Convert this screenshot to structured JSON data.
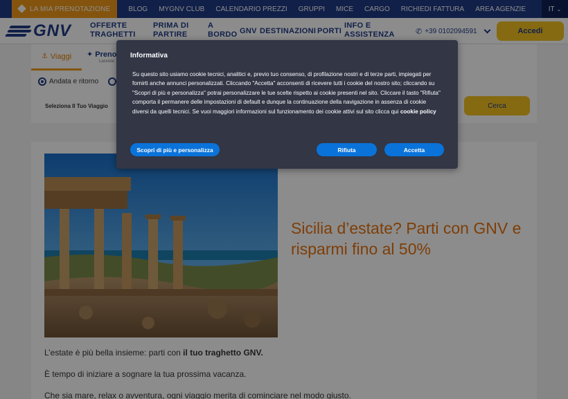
{
  "topbar": {
    "prenotazione": "LA MIA PRENOTAZIONE",
    "links": [
      "BLOG",
      "MYGNV CLUB",
      "CALENDARIO PREZZI",
      "GRUPPI",
      "MICE",
      "CARGO",
      "RICHIEDI FATTURA",
      "AREA AGENZIE"
    ],
    "language": "IT"
  },
  "nav": {
    "logo": "GNV",
    "items": [
      {
        "line1": "OFFERTE",
        "line2": "TRAGHETTI"
      },
      {
        "line1": "PRIMA DI",
        "line2": "PARTIRE"
      },
      {
        "line1": "A",
        "line2": "BORDO"
      },
      {
        "line1": "GNV",
        "line2": ""
      },
      {
        "line1": "DESTINAZIONI",
        "line2": ""
      },
      {
        "line1": "PORTI",
        "line2": ""
      },
      {
        "line1": "INFO E",
        "line2": "ASSISTENZA"
      }
    ],
    "phone": "+39 0102094591",
    "login": "Accedi"
  },
  "booking": {
    "tab_viaggi": "Viaggi",
    "tab_prenota": "Preno",
    "tab_prenota_sub": "Lassiste",
    "trip_type_selected": "Andata e ritorno",
    "select_label": "Seleziona Il Tuo Viaggio",
    "search": "Cerca"
  },
  "article": {
    "headline": "Sicilia d’estate? Parti con GNV e risparmi fino al 50%",
    "p1_pre": "L’estate è più bella insieme: parti con ",
    "p1_bold": "il tuo traghetto GNV.",
    "p2": "È tempo di iniziare a sognare la tua prossima vacanza.",
    "p3": "Che sia mare, relax o avventura, ogni viaggio merita di cominciare nel modo giusto."
  },
  "cookie_modal": {
    "title": "Informativa",
    "body": "Su questo sito usiamo cookie tecnici, analitici e, previo tuo consenso, di profilazione nostri e di terze parti, impiegati per fornirti anche annunci personalizzati. Cliccando \"Accetta\" acconsenti di ricevere tutti i cookie del nostro sito; cliccando su \"Scopri di più e personalizza\" potrai personalizzare le tue scelte rispetto ai cookie presenti nel sito. Cliccare il tasto \"Rifiuta\" comporta il permanere delle impostazioni di default e dunque la continuazione della navigazione in assenza di cookie diversi da quelli tecnici. Se vuoi maggiori informazioni sul funzionamento dei cookie attivi sul sito clicca qui ",
    "policy_link": "cookie policy",
    "btn_more": "Scopri di più e personalizza",
    "btn_reject": "Rifiuta",
    "btn_accept": "Accetta"
  },
  "colors": {
    "brand_blue": "#1f3b86",
    "orange": "#f19a1a",
    "yellow": "#f3c122",
    "modal_bg": "#323645",
    "button_blue": "#0a73da"
  }
}
